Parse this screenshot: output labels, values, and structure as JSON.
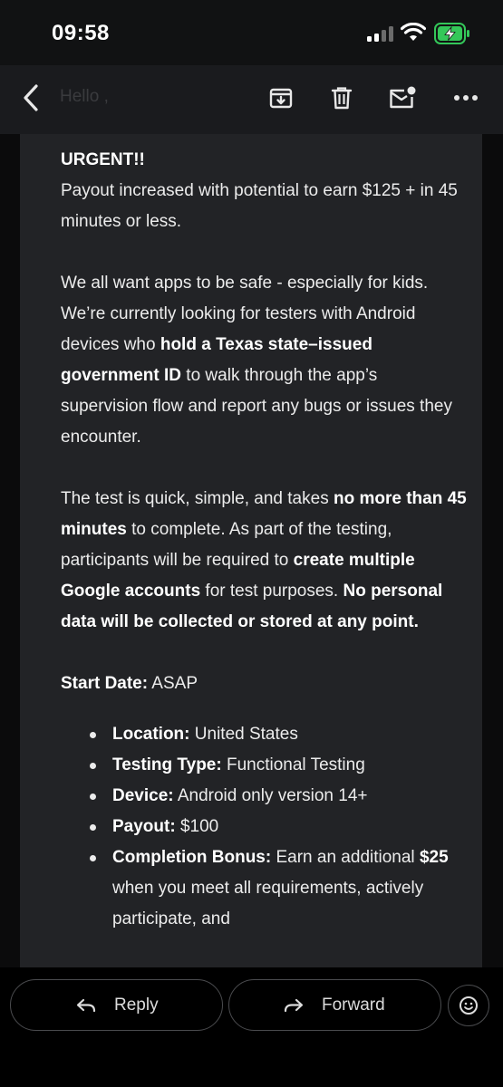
{
  "status_bar": {
    "time": "09:58",
    "signal_bars_active": 2,
    "battery": "charging"
  },
  "toolbar": {
    "subject_partial": "Hello ,",
    "icons": [
      "back-arrow-icon",
      "archive-icon",
      "trash-icon",
      "mark-unread-icon",
      "more-icon"
    ]
  },
  "email": {
    "p1_heading": "URGENT!!",
    "p1_text": "Payout increased with potential to earn $125 + in 45 minutes or less.",
    "p2_a": "We all want apps to be safe - especially for kids. We’re currently looking for testers with Android devices who ",
    "p2_b": "hold a Texas state–issued government ID",
    "p2_c": " to walk through the app’s supervision flow and report any bugs or issues they encounter.",
    "p3_a": "The test is quick, simple, and takes ",
    "p3_b": "no more than 45 minutes",
    "p3_c": " to complete. As part of the testing, participants will be required to ",
    "p3_d": "create multiple Google accounts",
    "p3_e": " for test purposes. ",
    "p3_f": "No personal data will be collected or stored at any point.",
    "start_label": "Start Date:",
    "start_value": " ASAP",
    "bullets": [
      {
        "label": "Location:",
        "value": " United States"
      },
      {
        "label": "Testing Type:",
        "value": " Functional Testing"
      },
      {
        "label": "Device:",
        "value": " Android only version 14+"
      },
      {
        "label": "Payout:",
        "value": " $100"
      },
      {
        "label": "Completion Bonus:",
        "value": " Earn an additional ",
        "bold2": "$25",
        "value2": " when you meet all requirements, actively participate, and"
      }
    ]
  },
  "actions": {
    "reply": "Reply",
    "forward": "Forward"
  },
  "colors": {
    "background": "#000000",
    "card": "#222326",
    "toolbar": "#1a1b1e",
    "battery": "#34c759"
  }
}
